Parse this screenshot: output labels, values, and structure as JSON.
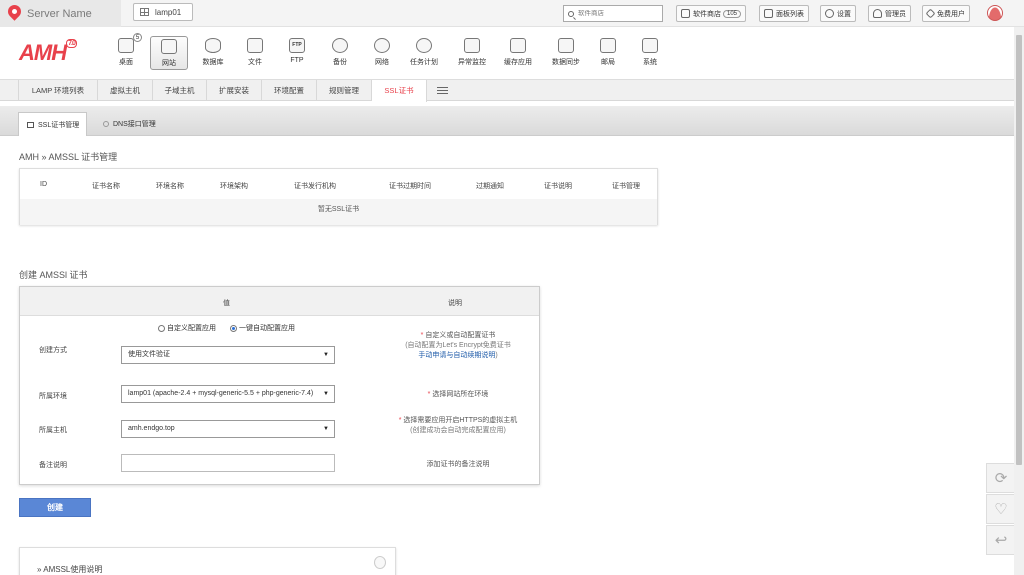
{
  "topbar": {
    "server_name": "Server Name",
    "env_button": "lamp01",
    "search_placeholder": "软件商店",
    "store_label": "软件商店",
    "store_count": "105",
    "panel_list": "面板列表",
    "settings": "设置",
    "admin": "管理员",
    "free_user": "免费用户"
  },
  "nav": {
    "logo": "AMH",
    "logo_sup": "7.0",
    "desktop_badge": "5",
    "items": [
      "桌面",
      "网站",
      "数据库",
      "文件",
      "FTP",
      "备份",
      "网络",
      "任务计划",
      "异常监控",
      "缓存应用",
      "数据同步",
      "邮局",
      "系统"
    ],
    "ftp_icon_text": "FTP"
  },
  "subnav": {
    "items": [
      "LAMP 环境列表",
      "虚拟主机",
      "子域主机",
      "扩展安装",
      "环境配置",
      "规则管理",
      "SSL证书"
    ]
  },
  "tabs": {
    "ssl_manage": "SSL证书管理",
    "dns_manage": "DNS接口管理"
  },
  "breadcrumb": "AMH » AMSSL 证书管理",
  "cert_table": {
    "headers": [
      "ID",
      "证书名称",
      "环境名称",
      "环境架构",
      "证书发行机构",
      "证书过期时间",
      "过期通知",
      "证书说明",
      "证书管理"
    ],
    "empty_text": "暂无SSL证书"
  },
  "create_title": "创建 AMSSl 证书",
  "form": {
    "col_value": "值",
    "col_desc": "说明",
    "row_method": {
      "label": "创建方式",
      "radio_custom": "自定义配置应用",
      "radio_auto": "一键自动配置应用",
      "select_value": "使用文件验证",
      "desc_line1": "自定义或自动配置证书",
      "desc_line2": "(自动配置为Let's Encrypt免费证书",
      "desc_link": "手动申请与自动续期说明",
      "desc_tail": ")"
    },
    "row_env": {
      "label": "所属环境",
      "select_value": "lamp01 (apache-2.4 + mysql-generic-5.5 + php-generic-7.4)",
      "desc": "选择网站所在环境"
    },
    "row_host": {
      "label": "所属主机",
      "select_value": "amh.endgo.top",
      "desc_line1": "选择需要应用开启HTTPS的虚拟主机",
      "desc_line2": "(创建成功会自动完成配置应用)"
    },
    "row_note": {
      "label": "备注说明",
      "value": "",
      "desc": "添加证书的备注说明"
    }
  },
  "create_button": "创建",
  "help_title": "» AMSSL使用说明",
  "colors": {
    "accent": "#e8414b",
    "button": "#5a87d6",
    "link": "#1d5aa8"
  }
}
